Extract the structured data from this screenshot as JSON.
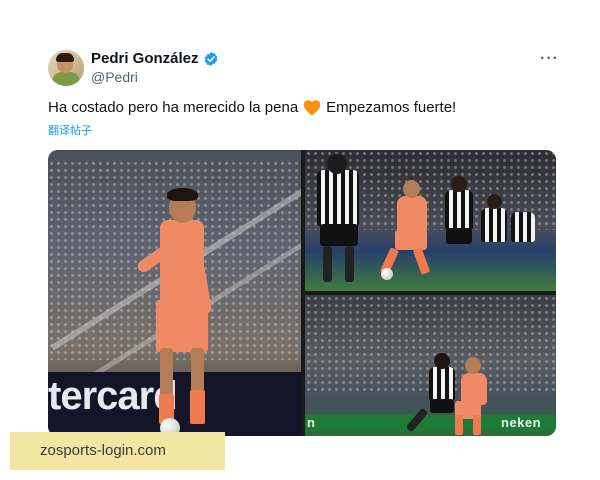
{
  "author": {
    "name": "Pedri González",
    "handle": "@Pedri",
    "verified": true
  },
  "menu": {
    "more_label": "···"
  },
  "tweet": {
    "text_before": "Ha costado pero ha merecido la pena",
    "emoji": "orange-heart",
    "text_after": "Empezamos fuerte!",
    "translate_label": "翻译帖子"
  },
  "media": {
    "count": 3,
    "main_board_text": "tercard",
    "bottom_ad_text": "n",
    "bottom_ad_text2": "neken"
  },
  "watermark": {
    "text": "zosports-login.com"
  },
  "colors": {
    "link_blue": "#1d9bf0",
    "kit_orange": "#f08a64",
    "verified_blue": "#1d9bf0",
    "watermark_bg": "#f3e6a3"
  }
}
